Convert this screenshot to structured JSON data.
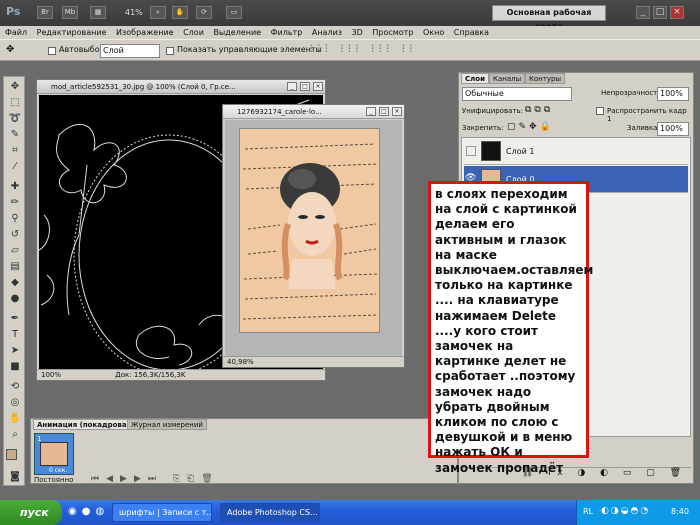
{
  "app": {
    "logo": "Ps",
    "zoom": "41%",
    "workspace_label": "Основная рабочая среда",
    "topbar_icons": [
      "bridge-icon",
      "minibridge-icon",
      "view-extras-icon",
      "zoom-icon",
      "hand-icon",
      "rotate-icon",
      "screen-mode-icon"
    ]
  },
  "menubar": {
    "items": [
      "Файл",
      "Редактирование",
      "Изображение",
      "Слои",
      "Выделение",
      "Фильтр",
      "Анализ",
      "3D",
      "Просмотр",
      "Окно",
      "Справка"
    ]
  },
  "options": {
    "autoselect_label": "Автовыбор:",
    "autoselect_value": "Слой",
    "show_controls_label": "Показать управляющие элементы"
  },
  "doc1": {
    "title": "mod_article592531_30.jpg @ 100% (Слой 0, Гр.се...",
    "zoom": "100%",
    "doc_info": "Док: 156,3K/156,3K"
  },
  "doc2": {
    "title": "1276932174_carole-lo...",
    "zoom": "40,98%"
  },
  "layers_panel": {
    "tabs": [
      "Слои",
      "Каналы",
      "Контуры"
    ],
    "blend_mode": "Обычные",
    "opacity_label": "Непрозрачность:",
    "opacity_value": "100%",
    "unify_label": "Унифицировать:",
    "propagate_label": "Распространить кадр 1",
    "lock_label": "Закрепить:",
    "fill_label": "Заливка:",
    "fill_value": "100%",
    "layers": [
      {
        "name": "Слой 1",
        "visible": false,
        "selected": false
      },
      {
        "name": "Слой 0",
        "visible": true,
        "selected": true
      }
    ],
    "selection_color": "#3a63b5"
  },
  "callout": {
    "text": "в слоях переходим на слой с картинкой делаем его активным и глазок на маске выключаем.оставляем только на картинке .... на клавиатуре нажимаем  Delete ....у кого стоит замочек на картинке  делет не сработает ..поэтому замочек надо убрать двойным кликом по слою с девушкой и в меню нажать ОК и замочек пропадёт",
    "border_color": "#e01010"
  },
  "anim_panel": {
    "tabs": [
      "Анимация (покадровая)",
      "Журнал измерений"
    ],
    "frame_number": "1",
    "frame_delay": "0 сек.",
    "loop_value": "Постоянно"
  },
  "taskbar": {
    "start_label": "пуск",
    "tasks": [
      {
        "label": "шрифты | Записи с т...",
        "active": false
      },
      {
        "label": "Adobe Photoshop CS...",
        "active": true
      }
    ],
    "lang": "RL",
    "time": "8:40"
  }
}
